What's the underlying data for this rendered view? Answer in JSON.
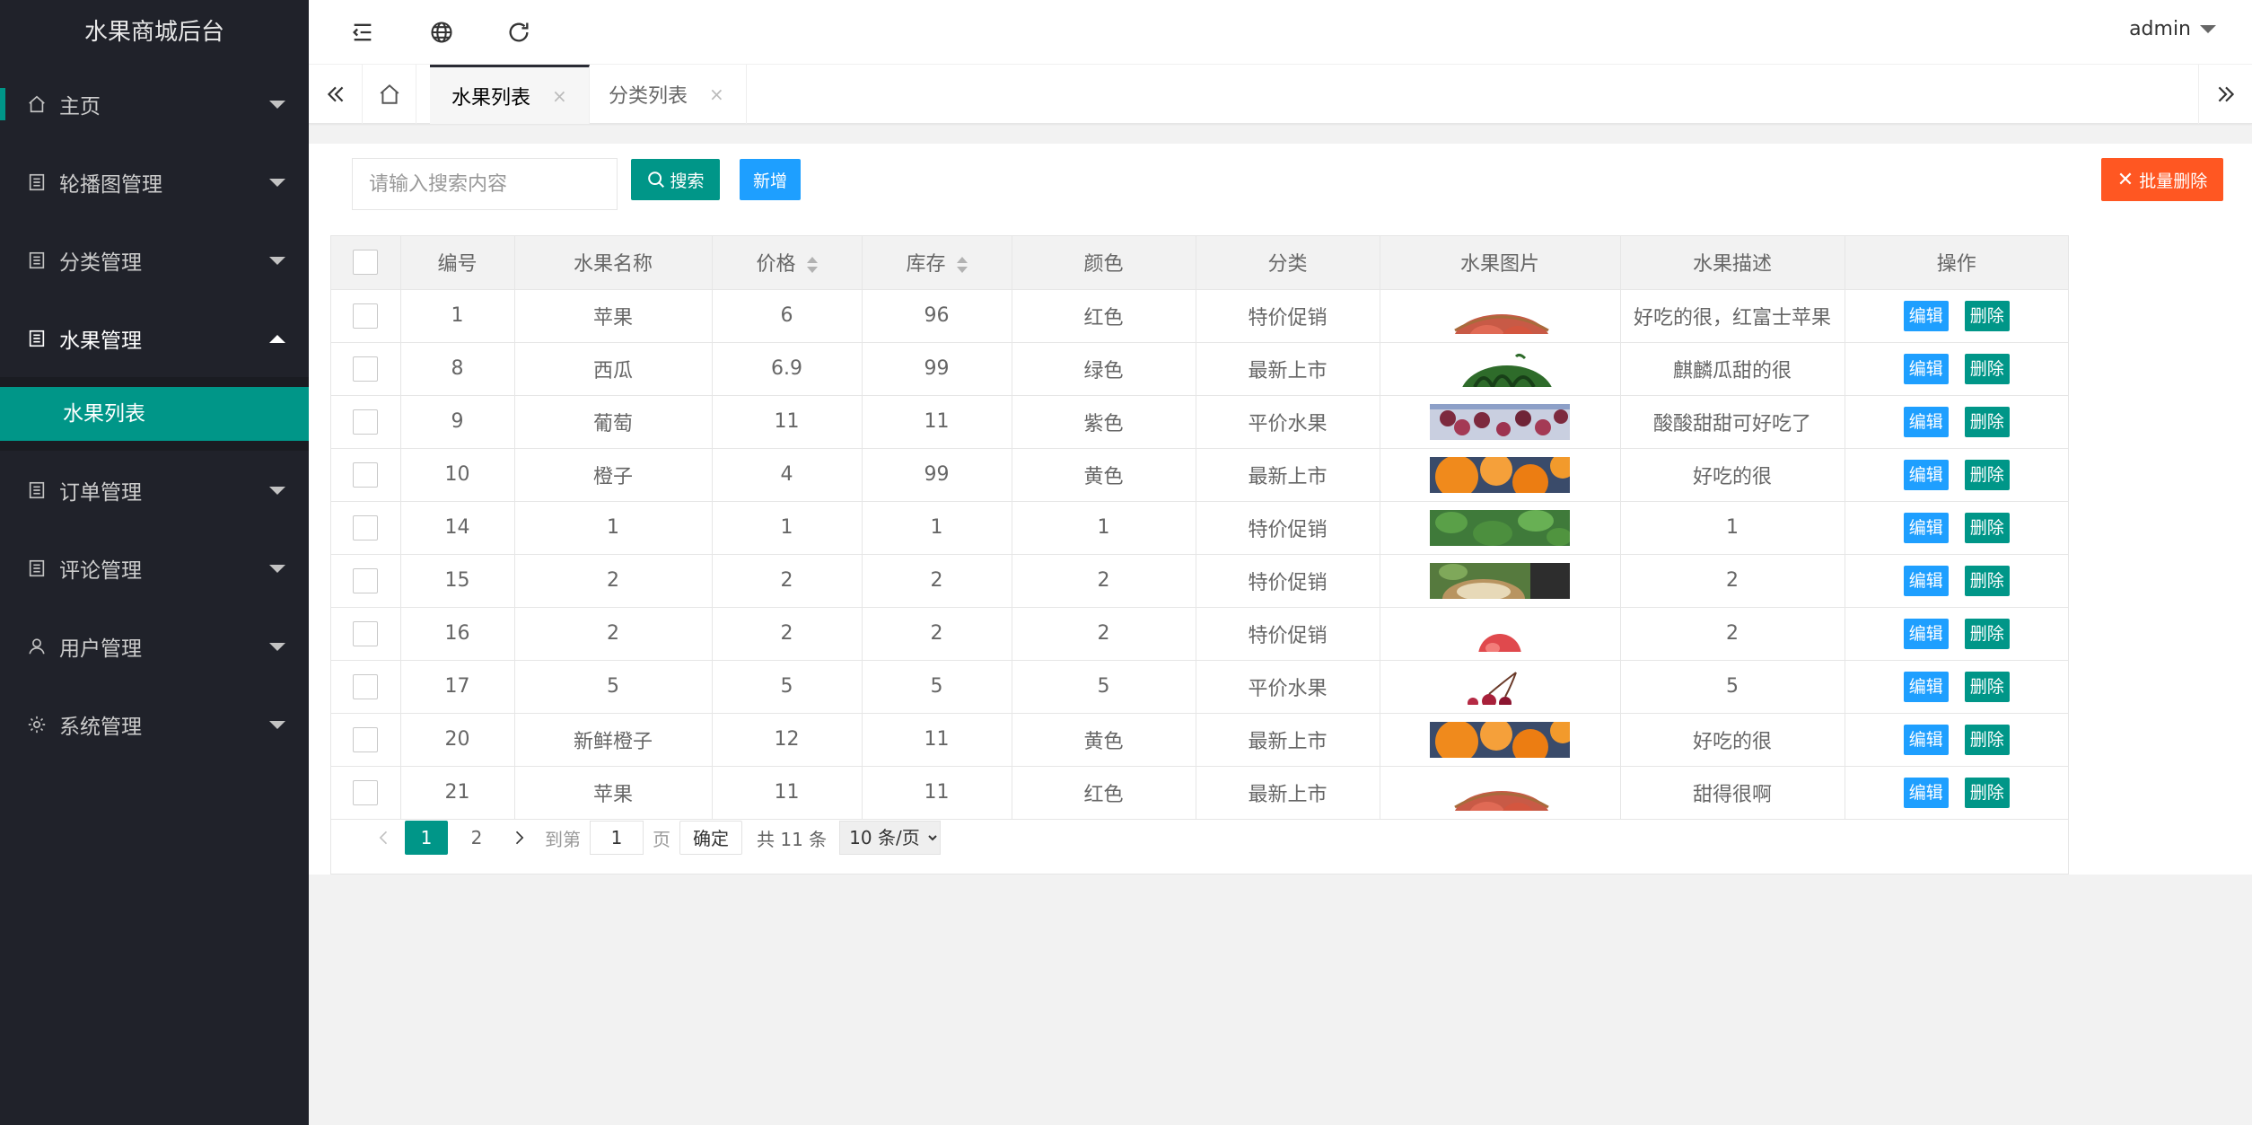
{
  "app": {
    "title": "水果商城后台"
  },
  "sidebar": {
    "items": [
      {
        "label": "主页"
      },
      {
        "label": "轮播图管理"
      },
      {
        "label": "分类管理"
      },
      {
        "label": "水果管理"
      },
      {
        "label": "订单管理"
      },
      {
        "label": "评论管理"
      },
      {
        "label": "用户管理"
      },
      {
        "label": "系统管理"
      }
    ],
    "submenu": {
      "label": "水果列表"
    }
  },
  "header": {
    "user": "admin"
  },
  "tabs": [
    {
      "label": "水果列表",
      "close": "×"
    },
    {
      "label": "分类列表",
      "close": "×"
    }
  ],
  "toolbar": {
    "search_placeholder": "请输入搜索内容",
    "search_label": "搜索",
    "add_label": "新增",
    "batch_delete_label": "批量删除"
  },
  "table": {
    "headers": [
      "编号",
      "水果名称",
      "价格",
      "库存",
      "颜色",
      "分类",
      "水果图片",
      "水果描述",
      "操作"
    ],
    "edit_label": "编辑",
    "delete_label": "删除",
    "rows": [
      {
        "id": "1",
        "name": "苹果",
        "price": "6",
        "stock": "96",
        "color": "红色",
        "category": "特价促销",
        "img": "apple",
        "desc": "好吃的很，红富士苹果"
      },
      {
        "id": "8",
        "name": "西瓜",
        "price": "6.9",
        "stock": "99",
        "color": "绿色",
        "category": "最新上市",
        "img": "melon",
        "desc": "麒麟瓜甜的很"
      },
      {
        "id": "9",
        "name": "葡萄",
        "price": "11",
        "stock": "11",
        "color": "紫色",
        "category": "平价水果",
        "img": "grape",
        "desc": "酸酸甜甜可好吃了"
      },
      {
        "id": "10",
        "name": "橙子",
        "price": "4",
        "stock": "99",
        "color": "黄色",
        "category": "最新上市",
        "img": "orange",
        "desc": "好吃的很"
      },
      {
        "id": "14",
        "name": "1",
        "price": "1",
        "stock": "1",
        "color": "1",
        "category": "特价促销",
        "img": "leaf",
        "desc": "1"
      },
      {
        "id": "15",
        "name": "2",
        "price": "2",
        "stock": "2",
        "color": "2",
        "category": "特价促销",
        "img": "basket",
        "desc": "2"
      },
      {
        "id": "16",
        "name": "2",
        "price": "2",
        "stock": "2",
        "color": "2",
        "category": "特价促销",
        "img": "peach",
        "desc": "2"
      },
      {
        "id": "17",
        "name": "5",
        "price": "5",
        "stock": "5",
        "color": "5",
        "category": "平价水果",
        "img": "cherry",
        "desc": "5"
      },
      {
        "id": "20",
        "name": "新鲜橙子",
        "price": "12",
        "stock": "11",
        "color": "黄色",
        "category": "最新上市",
        "img": "orange",
        "desc": "好吃的很"
      },
      {
        "id": "21",
        "name": "苹果",
        "price": "11",
        "stock": "11",
        "color": "红色",
        "category": "最新上市",
        "img": "apple",
        "desc": "甜得很啊"
      }
    ]
  },
  "pagination": {
    "pages": [
      "1",
      "2"
    ],
    "current": "1",
    "goto_label": "到第",
    "goto_value": "1",
    "page_unit": "页",
    "confirm_label": "确定",
    "total_label": "共 11 条",
    "page_size_option": "10 条/页"
  },
  "colors": {
    "primary": "#009688",
    "blue": "#1e9fff",
    "danger": "#ff5722",
    "sidebar": "#20222a"
  }
}
